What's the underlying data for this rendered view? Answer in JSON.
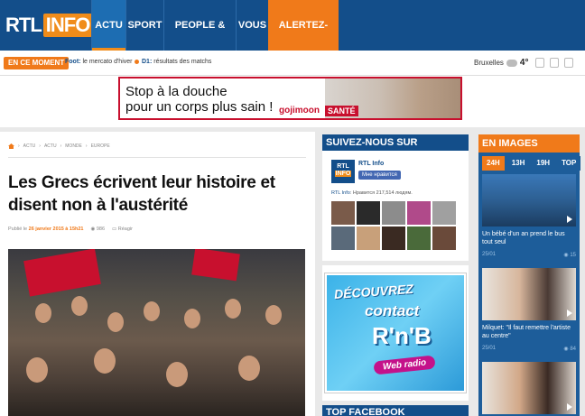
{
  "nav": {
    "logo_rtl": "RTL",
    "logo_info": "INFO",
    "items": [
      "ACTU",
      "SPORT",
      "PEOPLE & BUZZ",
      "VOUS",
      "ALERTEZ-NOUS"
    ]
  },
  "ticker": {
    "label": "EN CE MOMENT",
    "items": [
      {
        "source": "Foot:",
        "text": "le mercato d'hiver"
      },
      {
        "source": "D1:",
        "text": "résultats des matchs"
      }
    ],
    "weather": {
      "city": "Bruxelles",
      "temp": "4°"
    }
  },
  "ad": {
    "line1": "Stop à la douche",
    "line2": "pour un corps plus sain !",
    "brand": "gojimoon",
    "tag": "SANTÉ"
  },
  "article": {
    "breadcrumb": [
      "ACTU",
      "ACTU",
      "MONDE",
      "EUROPE"
    ],
    "headline": "Les Grecs écrivent leur histoire et disent non à l'austérité",
    "published_prefix": "Publié le",
    "published_date": "26 janvier 2015 à 15h21",
    "views": "986",
    "react": "Réagir"
  },
  "facebook": {
    "header": "SUIVEZ-NOUS SUR FACEBOOK",
    "page_name": "RTL Info",
    "like_button": "Мне нравится",
    "count_name": "RTL Info",
    "count_text": ": Нравится 217,514 людям."
  },
  "promo": {
    "line1": "DÉCOUVREZ",
    "line2": "contact",
    "line3": "R'n'B",
    "line4": "Web radio"
  },
  "top_facebook": {
    "header": "TOP FACEBOOK"
  },
  "images": {
    "header": "EN IMAGES",
    "tabs": [
      "24H",
      "13H",
      "19H",
      "TOP"
    ],
    "active_tab": "24H",
    "items": [
      {
        "caption": "Un bébé d'un an prend le bus tout seul",
        "date": "25/01",
        "views": "15"
      },
      {
        "caption": "Milquet: \"Il faut remettre l'artiste au centre\"",
        "date": "25/01",
        "views": "84"
      }
    ]
  },
  "colors": {
    "brand_blue": "#134e8a",
    "accent_orange": "#f07a1a"
  }
}
